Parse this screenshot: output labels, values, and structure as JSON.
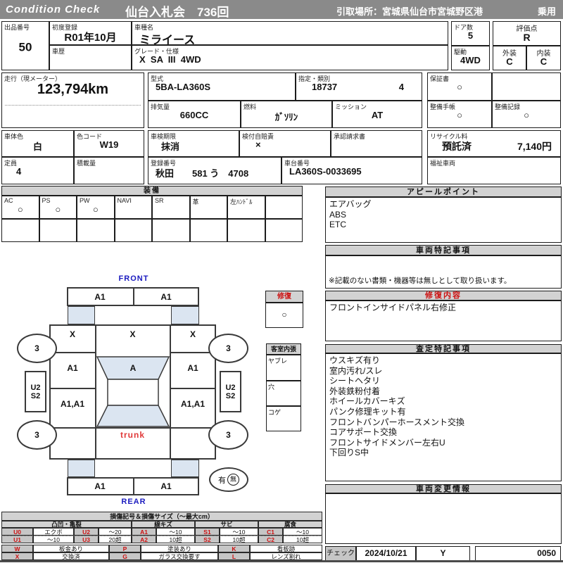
{
  "header": {
    "brand": "Condition  Check",
    "auction": "仙台入札会　736回",
    "pickup": "引取場所：宮城県仙台市宮城野区港",
    "usage": "乗用"
  },
  "info": {
    "lot_label": "出品番号",
    "lot_value": "50",
    "first_reg_label": "初度登録",
    "first_reg_value": "R01年10月",
    "history_label": "車歴",
    "history_value": "",
    "model_label": "車種名",
    "model_value": "ミライース",
    "grade_label": "グレード・仕様",
    "grade_value": "X  SA  III  4WD",
    "doors_label": "ドア数",
    "doors_value": "5",
    "drive_label": "駆動",
    "drive_value": "4WD",
    "score_label": "評価点",
    "score_value": "R",
    "exterior_label": "外装",
    "exterior_value": "C",
    "interior_label": "内装",
    "interior_value": "C",
    "mileage_label": "走行（現メーター）",
    "mileage_value": "123,794km",
    "model_code_label": "型式",
    "model_code_value": "5BA-LA360S",
    "class_label": "指定・類別",
    "class_value1": "18737",
    "class_value2": "4",
    "warranty_label": "保証書",
    "warranty_value": "○",
    "displacement_label": "排気量",
    "displacement_value": "660CC",
    "fuel_label": "燃料",
    "fuel_value": "ｶﾞｿﾘﾝ",
    "mission_label": "ミッション",
    "mission_value": "AT",
    "maint_book_label": "整備手帳",
    "maint_book_value": "○",
    "maint_record_label": "整備記録",
    "maint_record_value": "○",
    "color_label": "車体色",
    "color_value": "白",
    "color_code_label": "色コード",
    "color_code_value": "W19",
    "inspection_label": "車検期限",
    "inspection_value": "抹消",
    "insurance_label": "検付自賠責",
    "insurance_value": "×",
    "approval_label": "承認請求書",
    "approval_value": "",
    "recycle_label": "リサイクル料",
    "recycle_value1": "預託済",
    "recycle_value2": "7,140円",
    "capacity_label": "定員",
    "capacity_value": "4",
    "load_label": "積載量",
    "load_value": "",
    "plate_label": "登録番号",
    "plate_value": "秋田　　581 う　4708",
    "vin_label": "車台番号",
    "vin_value": "LA360S-0033695",
    "welfare_label": "福祉車両",
    "welfare_value": ""
  },
  "equipment": {
    "title": "装備",
    "items": [
      {
        "label": "AC",
        "value": "○"
      },
      {
        "label": "PS",
        "value": "○"
      },
      {
        "label": "PW",
        "value": "○"
      },
      {
        "label": "NAVI",
        "value": ""
      },
      {
        "label": "SR",
        "value": ""
      },
      {
        "label": "革",
        "value": ""
      },
      {
        "label": "左ﾊﾝﾄﾞﾙ",
        "value": ""
      },
      {
        "label": "",
        "value": ""
      }
    ]
  },
  "diagram": {
    "front_label": "FRONT",
    "rear_label": "REAR",
    "trunk_label": "trunk",
    "marks": {
      "front_bumper_left": "A1",
      "front_bumper_right": "A1",
      "fender_left": "X",
      "hood": "X",
      "fender_right": "X",
      "wheel_front_left": "3",
      "wheel_front_right": "3",
      "wheel_rear_left": "3",
      "wheel_rear_right": "3",
      "door_left": "A1",
      "windshield": "A",
      "door_right": "A1",
      "rocker_left": "U2\nS2",
      "rocker_right": "U2\nS2",
      "quarter_left": "A1,A1",
      "quarter_right": "A1,A1",
      "rear_bumper_left": "A1",
      "rear_bumper_right": "A1"
    },
    "repair": {
      "title": "修復",
      "value": "○"
    },
    "interior": {
      "title": "客室内張",
      "row1": "ヤブレ",
      "row2": "穴",
      "row3": "コゲ"
    },
    "spare": {
      "has": "有",
      "none": "無"
    }
  },
  "panels": {
    "appeal": {
      "title": "アピールポイント",
      "lines": [
        "エアバッグ",
        "ABS",
        "ETC"
      ]
    },
    "vehicle_notes": {
      "title": "車両特記事項",
      "note": "※記載のない書類・機器等は無しとして取り扱います。"
    },
    "repair_details": {
      "title": "修復内容",
      "lines": [
        "フロントインサイドパネル右修正"
      ]
    },
    "assessment": {
      "title": "査定特記事項",
      "lines": [
        "ウスキズ有り",
        "室内汚れ/スレ",
        "シートヘタリ",
        "外装鉄粉付着",
        "ホイールカバーキズ",
        "パンク修理キット有",
        "フロントバンパーホースメント交換",
        "コアサポート交換",
        "フロントサイドメンバー左右U",
        "下回りS中"
      ]
    },
    "change_info": {
      "title": "車両変更情報",
      "lines": []
    },
    "check": {
      "label": "チェック",
      "date": "2024/10/21",
      "inspector": "Y",
      "number": "0050"
    }
  },
  "legend": {
    "title": "損傷記号＆損傷サイズ（～最大cm）",
    "groups": [
      "凸凹・亀裂",
      "線キズ",
      "サビ",
      "腐食"
    ],
    "row1": [
      {
        "c": "U0",
        "d": "エクボ"
      },
      {
        "c": "U2",
        "d": "～20"
      },
      {
        "c": "A1",
        "d": "～10"
      },
      {
        "c": "S1",
        "d": "～10"
      },
      {
        "c": "C1",
        "d": "～10"
      }
    ],
    "row2": [
      {
        "c": "U1",
        "d": "～10"
      },
      {
        "c": "U3",
        "d": "20超"
      },
      {
        "c": "A2",
        "d": "10超"
      },
      {
        "c": "S2",
        "d": "10超"
      },
      {
        "c": "C2",
        "d": "10超"
      }
    ],
    "extra1": [
      {
        "c": "W",
        "d": "板金あり"
      },
      {
        "c": "P",
        "d": "塗装あり"
      },
      {
        "c": "K",
        "d": "看板跡"
      }
    ],
    "extra2": [
      {
        "c": "X",
        "d": "交換済"
      },
      {
        "c": "G",
        "d": "ガラス交換要す"
      },
      {
        "c": "L",
        "d": "レンズ割れ"
      }
    ]
  }
}
